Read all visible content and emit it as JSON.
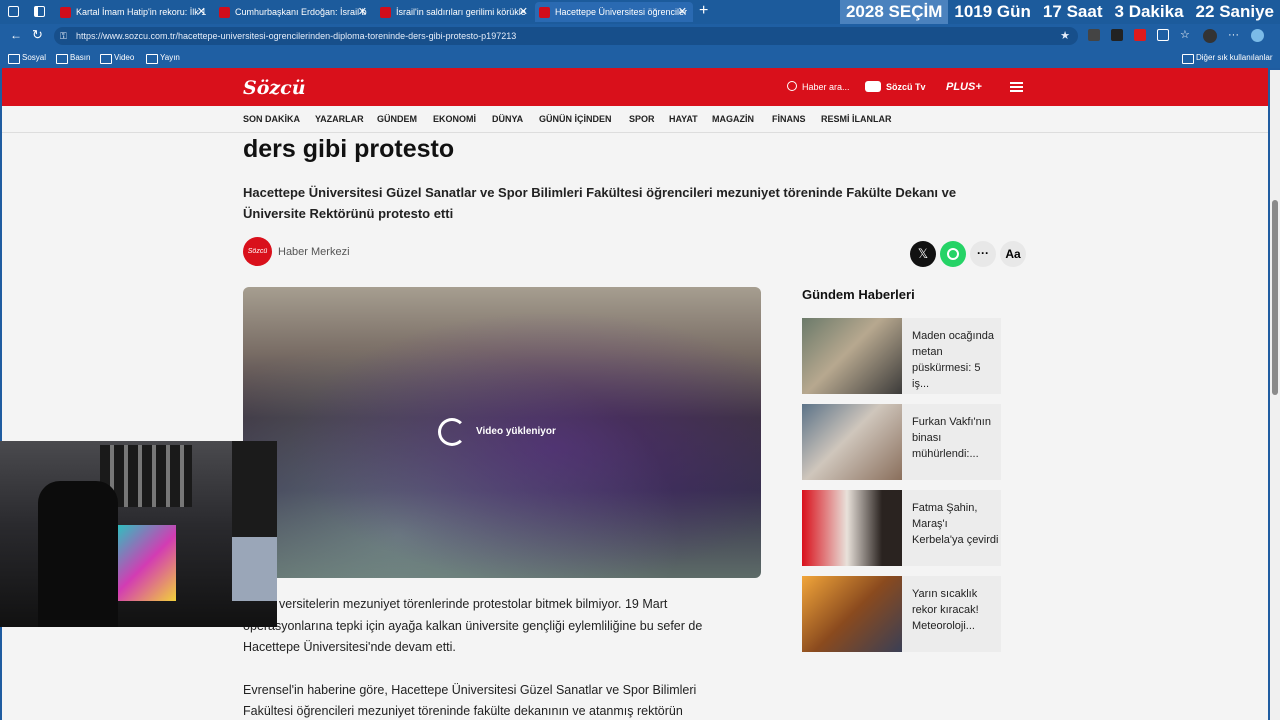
{
  "browser": {
    "tabs": [
      {
        "title": "Kartal İmam Hatip'in rekoru: İlk 1"
      },
      {
        "title": "Cumhurbaşkanı Erdoğan: İsrail b"
      },
      {
        "title": "İsrail'in saldırıları gerilimi körükle"
      },
      {
        "title": "Hacettepe Üniversitesi öğrenciler"
      }
    ],
    "new_tab": "+",
    "url": "https://www.sozcu.com.tr/hacettepe-universitesi-ogrencilerinden-diploma-toreninde-ders-gibi-protesto-p197213",
    "bookmarks": [
      "Sosyal",
      "Basın",
      "Video",
      "Yayın"
    ],
    "other_bookmarks": "Diğer sık kullanılanlar"
  },
  "countdown": {
    "year": "2028",
    "label": "SEÇİM",
    "days": "1019",
    "days_label": "Gün",
    "hours": "17",
    "hours_label": "Saat",
    "minutes": "3",
    "minutes_label": "Dakika",
    "seconds": "22",
    "seconds_label": "Saniye"
  },
  "site": {
    "logo": "Sözcü",
    "search_placeholder": "Haber ara...",
    "tv": "Sözcü Tv",
    "plus": "PLUS+",
    "nav": [
      "SON DAKİKA",
      "YAZARLAR",
      "GÜNDEM",
      "EKONOMİ",
      "DÜNYA",
      "GÜNÜN İÇİNDEN",
      "SPOR",
      "HAYAT",
      "MAGAZİN",
      "FİNANS",
      "RESMİ İLANLAR"
    ]
  },
  "article": {
    "title_tail": "ders gibi protesto",
    "subtitle": "Hacettepe Üniversitesi Güzel Sanatlar ve Spor Bilimleri Fakültesi öğrencileri mezuniyet töreninde Fakülte Dekanı ve Üniversite Rektörünü protesto etti",
    "author": "Haber Merkezi",
    "author_badge": "Sözcü",
    "video_status": "Video yükleniyor",
    "text_size": "Aa",
    "para1_a": "versitelerin mezuniyet törenlerinde protestolar bitmek bilmiyor. 19 Mart",
    "para1_b": "operasyonlarına tepki için ayağa kalkan üniversite gençliği eylemliliğine bu sefer de",
    "para1_c": "Hacettepe Üniversitesi'nde devam etti.",
    "para2_a": "Evrensel'in haberine göre, Hacettepe Üniversitesi Güzel Sanatlar ve Spor Bilimleri",
    "para2_b": "Fakültesi öğrencileri mezuniyet töreninde fakülte dekanının ve atanmış rektörün"
  },
  "sidebar": {
    "heading": "Gündem Haberleri",
    "items": [
      {
        "title": "Maden ocağında metan püskürmesi: 5 iş..."
      },
      {
        "title": "Furkan Vakfı'nın binası mühürlendi:..."
      },
      {
        "title": "Fatma Şahin, Maraş'ı Kerbela'ya çevirdi"
      },
      {
        "title": "Yarın sıcaklık rekor kıracak! Meteoroloji..."
      }
    ]
  },
  "colors": {
    "brand_red": "#d9101b",
    "browser_blue": "#1c5b9c"
  }
}
